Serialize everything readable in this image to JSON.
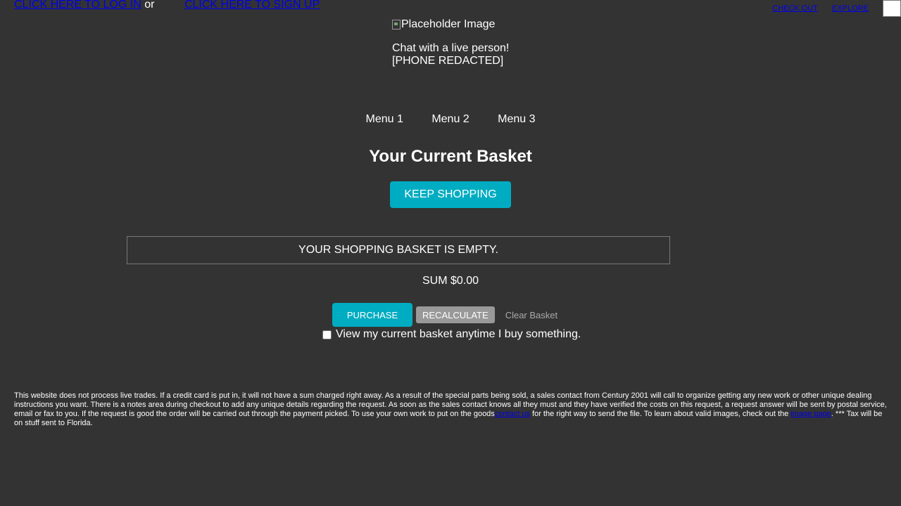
{
  "header": {
    "login_link": "CLICK HERE TO LOG IN",
    "or_text": "or",
    "signup_link": "CLICK HERE TO SIGN UP",
    "checkout_link": "CHECK OUT",
    "explore_link": "EXPLORE"
  },
  "contact": {
    "image_alt": "Placeholder Image",
    "chat_text": "Chat with a live person!",
    "phone": "[PHONE REDACTED]"
  },
  "menu": {
    "items": [
      "Menu 1",
      "Menu 2",
      "Menu 3"
    ]
  },
  "basket": {
    "title": "Your Current Basket",
    "keep_shopping_label": "KEEP SHOPPING",
    "empty_message": "YOUR SHOPPING BASKET IS EMPTY.",
    "sum_text": "SUM $0.00",
    "purchase_label": "PURCHASE",
    "recalculate_label": "RECALCULATE",
    "clear_label": "Clear Basket",
    "view_checkbox_label": "View my current basket anytime I buy something.",
    "view_checkbox_checked": false
  },
  "footer": {
    "disclaimer_part1": "This website does not process live trades. If a credit card is put in, it will not have a sum charged right away. As a result of the special parts being sold, a sales contact from Century 2001 will call to organize getting any new work or other unique dealing instructions you want. There is a notes area during checkout to add any unique details regarding the request. As soon as the sales contact knows all they must and they have verified the costs on this request, a request answer will be sent by postal service, email or fax to you. If the request is good the order will be carried out through the payment picked. To use your own work to put on the goods",
    "contact_link": "contact us",
    "disclaimer_part2": "for the right way to send the file. To learn about valid images, check out the",
    "image_page_link": "image page",
    "disclaimer_part3": ". *** Tax will be on stuff sent to Florida."
  },
  "colors": {
    "background": "#333333",
    "accent": "#00acc1",
    "secondary_button": "#999999",
    "link": "#0000ee"
  }
}
